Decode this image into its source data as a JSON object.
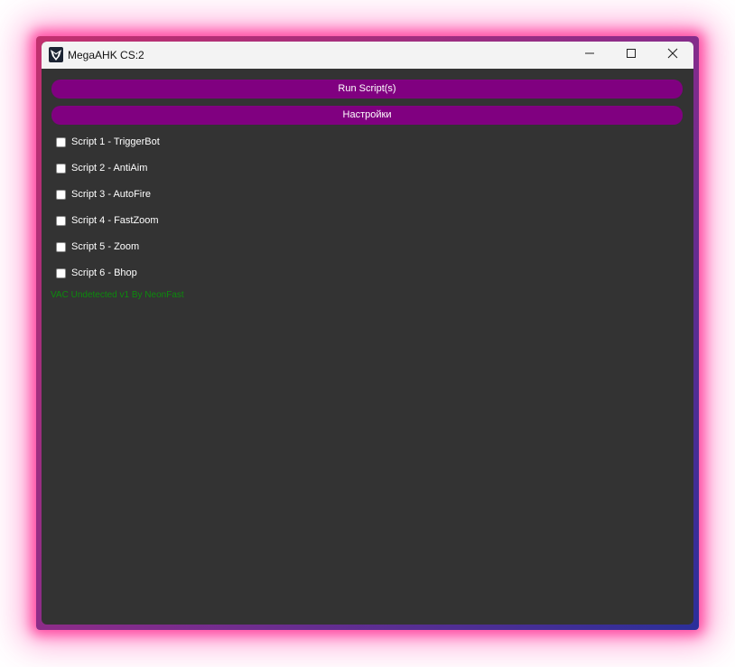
{
  "window": {
    "title": "MegaAHK CS:2",
    "app_icon": "winged-logo-icon",
    "controls": {
      "minimize_icon": "minimize-icon",
      "maximize_icon": "maximize-icon",
      "close_icon": "close-icon"
    }
  },
  "actions": {
    "run_label": "Run Script(s)",
    "settings_label": "Настройки",
    "button_color": "#800080"
  },
  "scripts": [
    {
      "label": "Script 1 - TriggerBot",
      "checked": false
    },
    {
      "label": "Script 2 - AntiAim",
      "checked": false
    },
    {
      "label": "Script 3 - AutoFire",
      "checked": false
    },
    {
      "label": "Script 4 - FastZoom",
      "checked": false
    },
    {
      "label": "Script 5 - Zoom",
      "checked": false
    },
    {
      "label": "Script 6 - Bhop",
      "checked": false
    }
  ],
  "footer": {
    "note": "VAC Undetected v1 By NeonFast",
    "color": "#0d8a0d"
  },
  "theme": {
    "background": "#333333",
    "titlebar": "#f3f3f3",
    "glow": "#ff3c9a"
  }
}
